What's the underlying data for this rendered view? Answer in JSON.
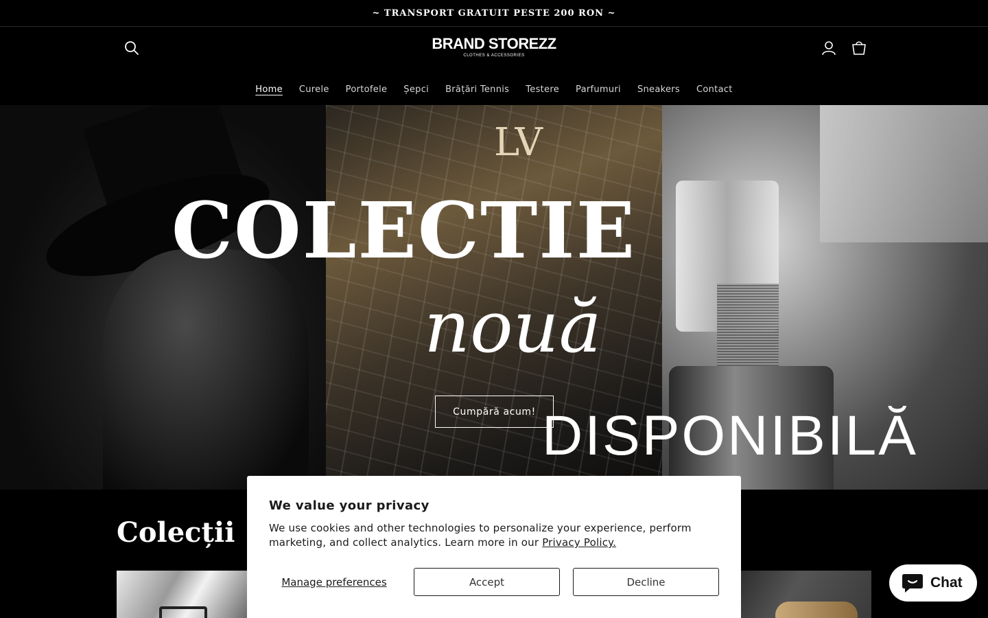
{
  "announcement": {
    "text": "~ TRANSPORT GRATUIT PESTE 200 RON ~"
  },
  "header": {
    "logo_main": "BRAND STOREZZ",
    "logo_sub": "CLOTHES & ACCESSORIES",
    "icons": {
      "search": "search-icon",
      "account": "account-icon",
      "cart": "cart-icon"
    }
  },
  "nav": {
    "items": [
      {
        "label": "Home",
        "active": true
      },
      {
        "label": "Curele"
      },
      {
        "label": "Portofele"
      },
      {
        "label": "Șepci"
      },
      {
        "label": "Brățări Tennis"
      },
      {
        "label": "Testere"
      },
      {
        "label": "Parfumuri"
      },
      {
        "label": "Sneakers"
      },
      {
        "label": "Contact"
      }
    ]
  },
  "hero": {
    "line1": "COLECTIE",
    "line2": "nouă",
    "line3": "DISPONIBILĂ",
    "cta_label": "Cumpără acum!"
  },
  "collections": {
    "title": "Colecții"
  },
  "cookie_banner": {
    "title": "We value your privacy",
    "text": "We use cookies and other technologies to personalize your experience, perform marketing, and collect analytics. Learn more in our ",
    "link": "Privacy Policy.",
    "manage_label": "Manage preferences",
    "accept_label": "Accept",
    "decline_label": "Decline"
  },
  "chat": {
    "label": "Chat",
    "icon": "chat-bubble-icon"
  },
  "colors": {
    "background": "#000000",
    "text": "#ffffff",
    "banner_bg": "#ffffff",
    "banner_text": "#1a1a1a"
  }
}
